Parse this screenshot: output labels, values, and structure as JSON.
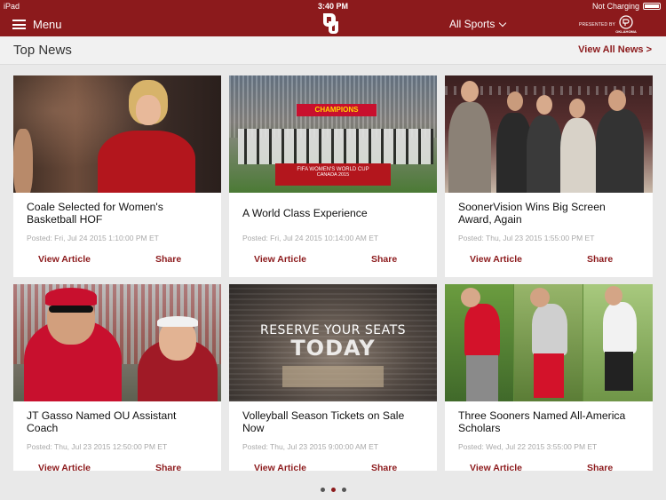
{
  "status_bar": {
    "device": "iPad",
    "time": "3:40 PM",
    "charging": "Not Charging"
  },
  "nav": {
    "menu_label": "Menu",
    "sports_label": "All Sports",
    "presented_by": "PRESENTED BY",
    "sponsor_text": "OKLAHOMA"
  },
  "section": {
    "title": "Top News",
    "view_all": "View All News >"
  },
  "image_text": {
    "champions": "CHAMPIONS",
    "world_cup": "FIFA WOMEN'S WORLD CUP",
    "canada": "CANADA 2015",
    "reserve": "RESERVE YOUR SEATS",
    "today": "TODAY"
  },
  "cards": [
    {
      "title": "Coale Selected for Women's Basketball HOF",
      "date": "Posted: Fri, Jul 24 2015 1:10:00 PM ET",
      "view": "View Article",
      "share": "Share"
    },
    {
      "title": "A World Class Experience",
      "date": "Posted: Fri, Jul 24 2015 10:14:00 AM ET",
      "view": "View Article",
      "share": "Share"
    },
    {
      "title": "SoonerVision Wins Big Screen Award, Again",
      "date": "Posted: Thu, Jul 23 2015 1:55:00 PM ET",
      "view": "View Article",
      "share": "Share"
    },
    {
      "title": "JT Gasso Named OU Assistant Coach",
      "date": "Posted: Thu, Jul 23 2015 12:50:00 PM ET",
      "view": "View Article",
      "share": "Share"
    },
    {
      "title": "Volleyball Season Tickets on Sale Now",
      "date": "Posted: Thu, Jul 23 2015 9:00:00 AM ET",
      "view": "View Article",
      "share": "Share"
    },
    {
      "title": "Three Sooners Named All-America Scholars",
      "date": "Posted: Wed, Jul 22 2015 3:55:00 PM ET",
      "view": "View Article",
      "share": "Share"
    }
  ],
  "pager": {
    "pages": 3,
    "current": 2
  },
  "colors": {
    "brand": "#8c1a1c",
    "background": "#e9e9e9",
    "date_gray": "#a9a9a9"
  }
}
